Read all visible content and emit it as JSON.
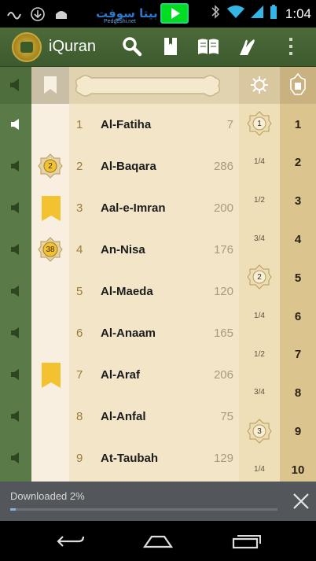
{
  "app": {
    "title": "iQuran"
  },
  "watermark": {
    "text": "بيتا سوفت",
    "sub": "Pedgeshi.net"
  },
  "status": {
    "time": "1:04"
  },
  "surahs": [
    {
      "num": "1",
      "name": "Al-Fatiha",
      "verses": "7"
    },
    {
      "num": "2",
      "name": "Al-Baqara",
      "verses": "286"
    },
    {
      "num": "3",
      "name": "Aal-e-Imran",
      "verses": "200"
    },
    {
      "num": "4",
      "name": "An-Nisa",
      "verses": "176"
    },
    {
      "num": "5",
      "name": "Al-Maeda",
      "verses": "120"
    },
    {
      "num": "6",
      "name": "Al-Anaam",
      "verses": "165"
    },
    {
      "num": "7",
      "name": "Al-Araf",
      "verses": "206"
    },
    {
      "num": "8",
      "name": "Al-Anfal",
      "verses": "75"
    },
    {
      "num": "9",
      "name": "At-Taubah",
      "verses": "129"
    }
  ],
  "bookmark_medals": [
    "2",
    "38"
  ],
  "page_medals": [
    "1",
    "2",
    "3"
  ],
  "page_fractions": [
    "1/4",
    "1/2",
    "3/4",
    "1/4",
    "1/2",
    "3/4",
    "1/4"
  ],
  "juz": [
    "1",
    "2",
    "3",
    "4",
    "5",
    "6",
    "7",
    "8",
    "9",
    "10"
  ],
  "download": {
    "label": "Downloaded 2%",
    "progress": 0.02
  },
  "colors": {
    "accent_green": "#4c6a39",
    "bookmark_yellow": "#f2c230",
    "gold": "#c9a93a"
  }
}
